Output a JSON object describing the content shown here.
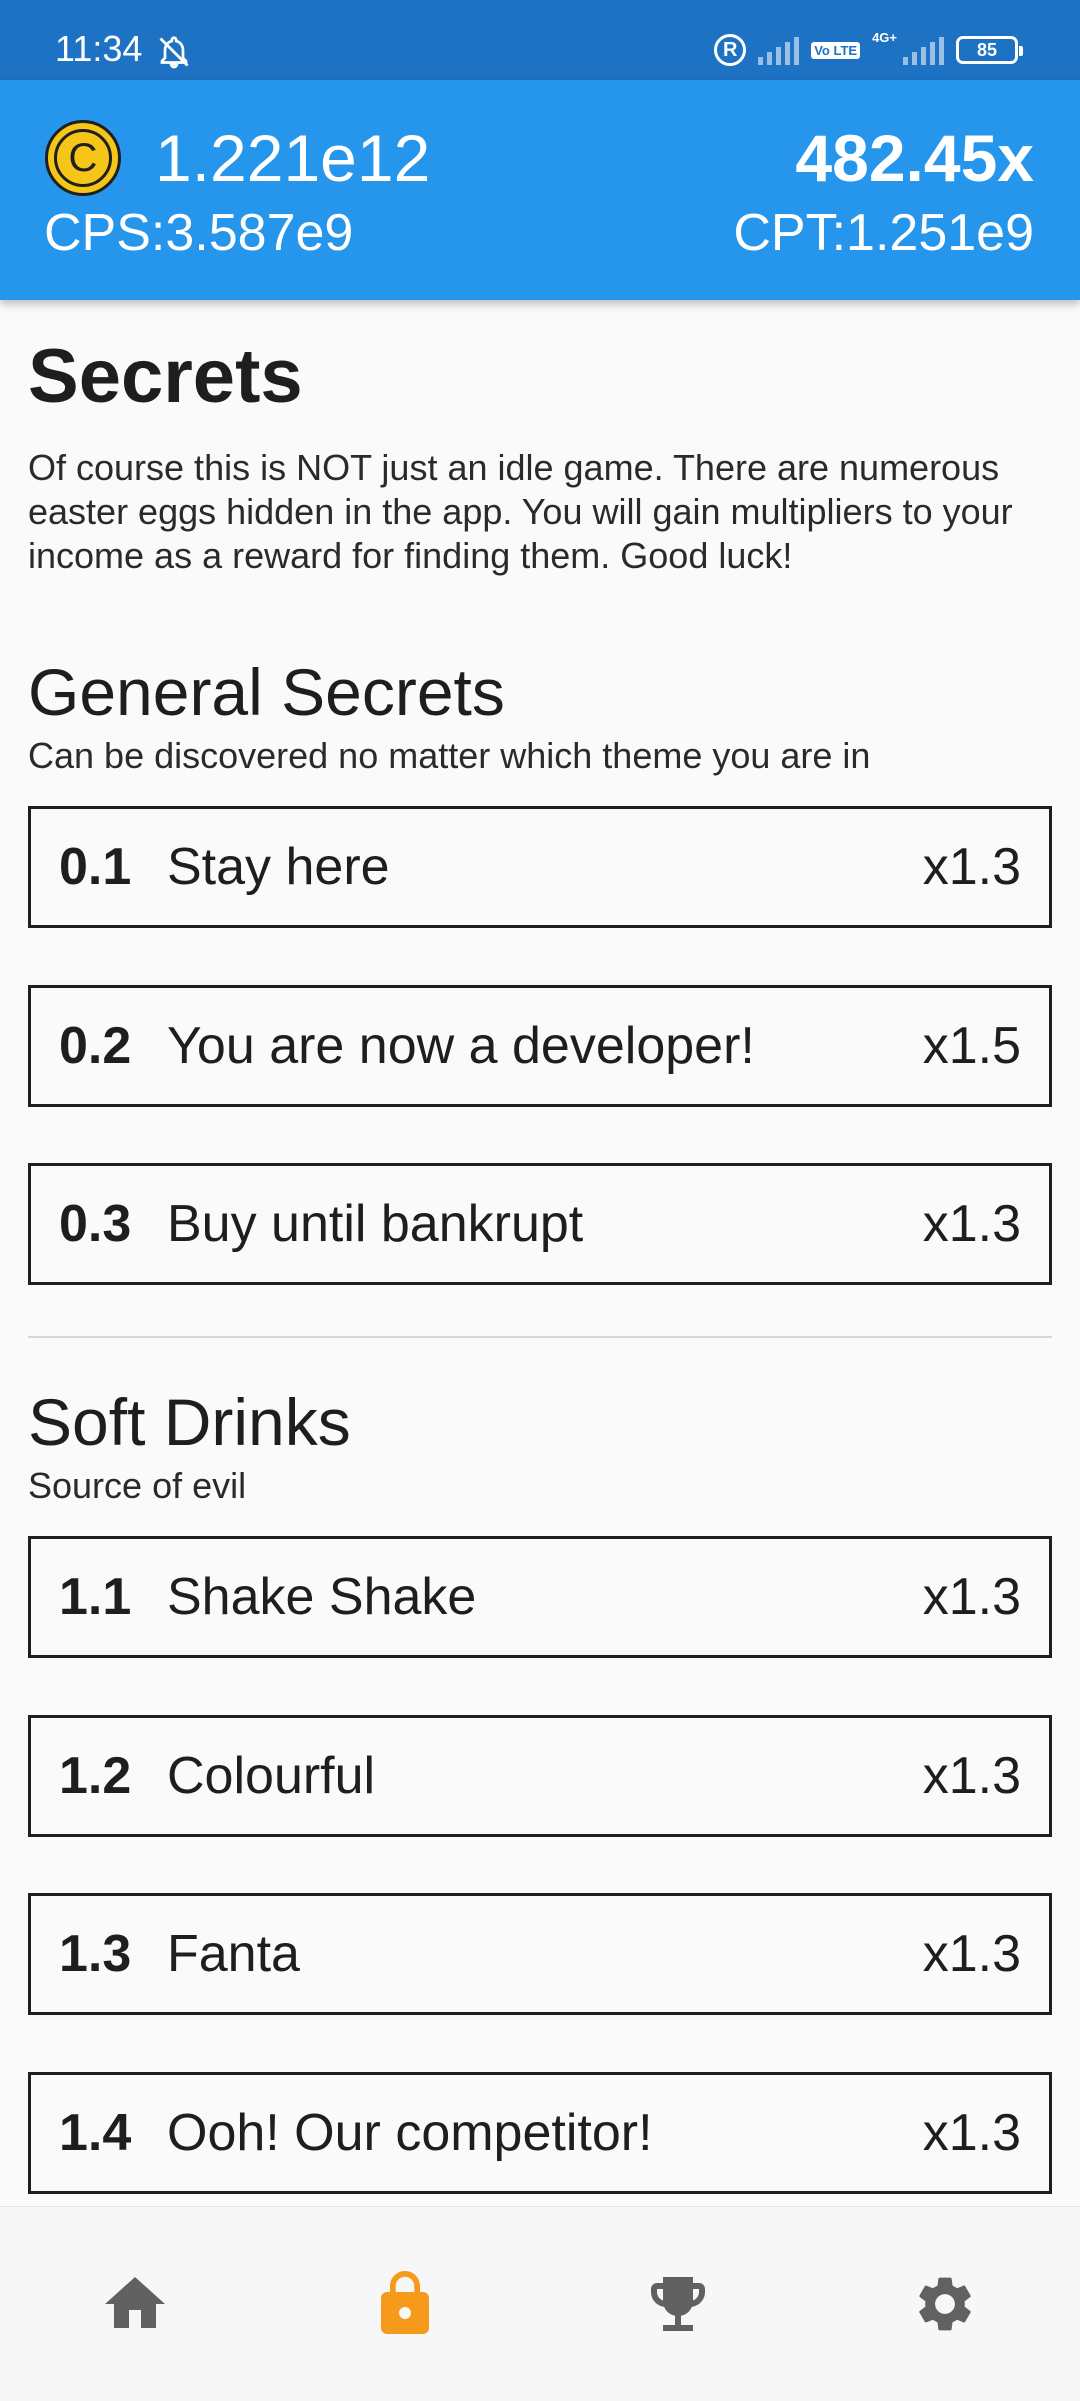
{
  "status_bar": {
    "time": "11:34",
    "battery": "85",
    "network": "4G+",
    "volte": "Vo LTE",
    "r_label": "R"
  },
  "header": {
    "coins": "1.221e12",
    "multiplier": "482.45x",
    "cps": "CPS:3.587e9",
    "cpt": "CPT:1.251e9",
    "coin_symbol": "C"
  },
  "page": {
    "title": "Secrets",
    "intro": "Of course this is NOT just an idle game. There are numerous easter eggs hidden in the app. You will gain multipliers to your income as a reward for finding them. Good luck!"
  },
  "sections": [
    {
      "title": "General Secrets",
      "subtitle": "Can be discovered no matter which theme you are in",
      "items": [
        {
          "num": "0.1",
          "name": "Stay here",
          "mult": "x1.3"
        },
        {
          "num": "0.2",
          "name": "You are now a developer!",
          "mult": "x1.5"
        },
        {
          "num": "0.3",
          "name": "Buy until bankrupt",
          "mult": "x1.3"
        }
      ]
    },
    {
      "title": "Soft Drinks",
      "subtitle": "Source of evil",
      "items": [
        {
          "num": "1.1",
          "name": "Shake Shake",
          "mult": "x1.3"
        },
        {
          "num": "1.2",
          "name": "Colourful",
          "mult": "x1.3"
        },
        {
          "num": "1.3",
          "name": "Fanta",
          "mult": "x1.3"
        },
        {
          "num": "1.4",
          "name": "Ooh! Our competitor!",
          "mult": "x1.3"
        }
      ]
    }
  ],
  "bottom_nav": {
    "items": [
      {
        "icon": "home-icon",
        "active": false
      },
      {
        "icon": "lock-icon",
        "active": true
      },
      {
        "icon": "trophy-icon",
        "active": false
      },
      {
        "icon": "settings-icon",
        "active": false
      }
    ]
  },
  "colors": {
    "status_bar": "#1e72c4",
    "header": "#2596eb",
    "coin": "#f5c518",
    "nav_active": "#f59a1b",
    "nav_inactive": "#616161"
  }
}
